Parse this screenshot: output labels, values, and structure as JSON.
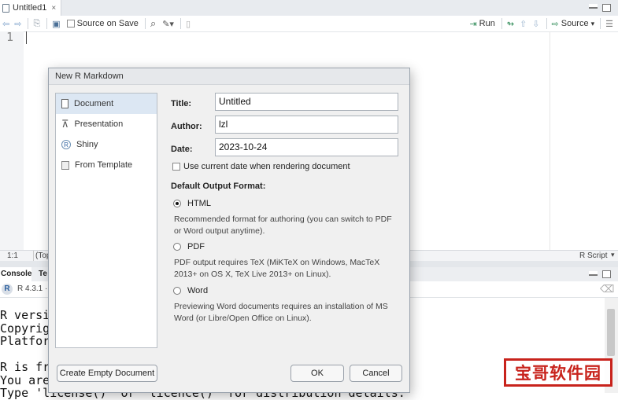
{
  "editor": {
    "tab_title": "Untitled1",
    "tab_close": "×",
    "source_on_save": "Source on Save",
    "run_label": "Run",
    "source_label": "Source",
    "line_number": "1",
    "status_position": "1:1",
    "status_scope": "(Top",
    "status_filetype": "R Script"
  },
  "console": {
    "tabs": [
      "Console",
      "Te"
    ],
    "r_version": "R 4.3.1 ·",
    "lines": [
      "R versio",
      "Copyrigh",
      "Platform",
      "",
      "R is fre",
      "You are ",
      "Type 'license()' or 'licence()' for distribution details."
    ]
  },
  "dialog": {
    "title": "New R Markdown",
    "left_items": [
      {
        "label": "Document"
      },
      {
        "label": "Presentation"
      },
      {
        "label": "Shiny"
      },
      {
        "label": "From Template"
      }
    ],
    "fields": {
      "title_label": "Title:",
      "title_value": "Untitled",
      "author_label": "Author:",
      "author_value": "lzl",
      "date_label": "Date:",
      "date_value": "2023-10-24"
    },
    "use_current_date": "Use current date when rendering document",
    "output_format_heading": "Default Output Format:",
    "formats": [
      {
        "label": "HTML",
        "desc1": "Recommended format for authoring (you can switch to PDF",
        "desc2": "or Word output anytime)."
      },
      {
        "label": "PDF",
        "desc1": "PDF output requires TeX (MiKTeX on Windows, MacTeX",
        "desc2": "2013+ on OS X, TeX Live 2013+ on Linux)."
      },
      {
        "label": "Word",
        "desc1": "Previewing Word documents requires an installation of MS",
        "desc2": "Word (or Libre/Open Office on Linux)."
      }
    ],
    "create_empty": "Create Empty Document",
    "ok": "OK",
    "cancel": "Cancel"
  },
  "watermark": "宝哥软件园"
}
